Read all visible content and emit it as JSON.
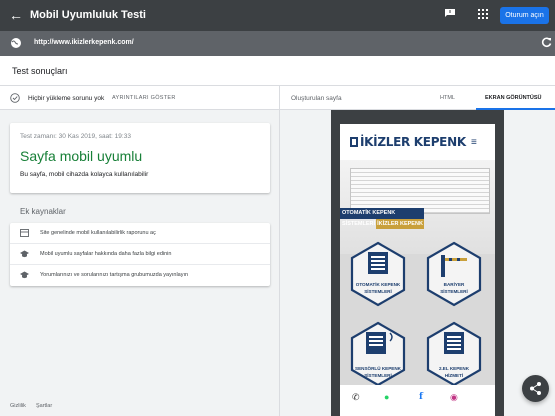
{
  "header": {
    "title": "Mobil Uyumluluk Testi",
    "signin_label": "Oturum açın"
  },
  "urlbar": {
    "url": "http://www.ikizlerkepenk.com/"
  },
  "results": {
    "title": "Test sonuçları",
    "status_text": "Hiçbir yükleme sorunu yok",
    "details_link": "AYRINTILARI GÖSTER",
    "test_time": "Test zamanı: 30 Kas 2019, saat: 19:33",
    "verdict": "Sayfa mobil uyumlu",
    "verdict_desc": "Bu sayfa, mobil cihazda kolayca kullanılabilir",
    "extra_label": "Ek kaynaklar",
    "resources": [
      {
        "icon": "report-icon",
        "text": "Site genelinde mobil kullanılabilirlik raporunu aç"
      },
      {
        "icon": "school-icon",
        "text": "Mobil uyumlu sayfalar hakkında daha fazla bilgi edinin"
      },
      {
        "icon": "forum-icon",
        "text": "Yorumlarınızı ve sorularınızı tartışma grubumuzda yayınlayın"
      }
    ]
  },
  "preview": {
    "generated_label": "Oluşturulan sayfa",
    "tab_html": "HTML",
    "tab_screenshot": "EKRAN GÖRÜNTÜSÜ",
    "site": {
      "logo": "İKİZLER KEPENK",
      "banner_title": "OTOMATİK KEPENK SİSTEMLERİ",
      "banner_sub": "İKİZLER KEPENK",
      "products": [
        {
          "label_1": "OTOMATİK KEPENK",
          "label_2": "SİSTEMLERİ"
        },
        {
          "label_1": "BARİYER",
          "label_2": "SİSTEMLERİ"
        },
        {
          "label_1": "SENSÖRLÜ KEPENK",
          "label_2": "SİSTEMLERİ"
        },
        {
          "label_1": "2.EL KEPENK",
          "label_2": "HİZMETİ"
        }
      ]
    }
  },
  "footer": {
    "privacy": "Gizlilik",
    "terms": "Şartlar"
  },
  "colors": {
    "success": "#188038",
    "primary": "#1a73e8",
    "brand_navy": "#1d3e6e",
    "brand_gold": "#c9a03b"
  }
}
